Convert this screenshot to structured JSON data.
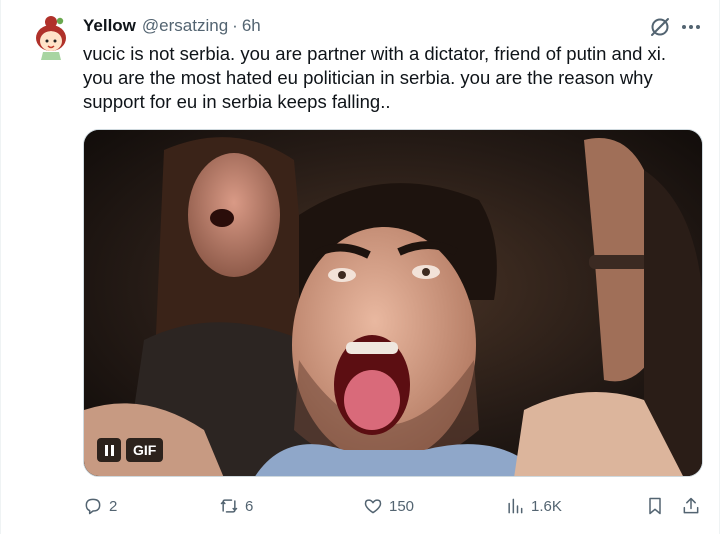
{
  "tweet": {
    "author_name": "Yellow",
    "author_handle": "@ersatzing",
    "separator": "·",
    "time": "6h",
    "text": "vucic is not serbia. you are partner with a dictator, friend of putin and xi.\nyou are the most hated eu politician in serbia. you are the reason why\nsupport for eu in serbia keeps falling..",
    "media": {
      "type": "gif",
      "badge_label": "GIF"
    }
  },
  "actions": {
    "replies": "2",
    "retweets": "6",
    "likes": "150",
    "views": "1.6K"
  },
  "icons": {
    "avatar": "cartoon-girl-avatar",
    "grok": "grok-icon",
    "more": "more-dots-icon",
    "reply": "reply-icon",
    "retweet": "retweet-icon",
    "like": "heart-icon",
    "views": "views-chart-icon",
    "bookmark": "bookmark-icon",
    "share": "share-icon",
    "pause": "pause-icon"
  },
  "colors": {
    "text": "#0f1419",
    "secondary": "#536471",
    "border": "#cfd9de"
  }
}
